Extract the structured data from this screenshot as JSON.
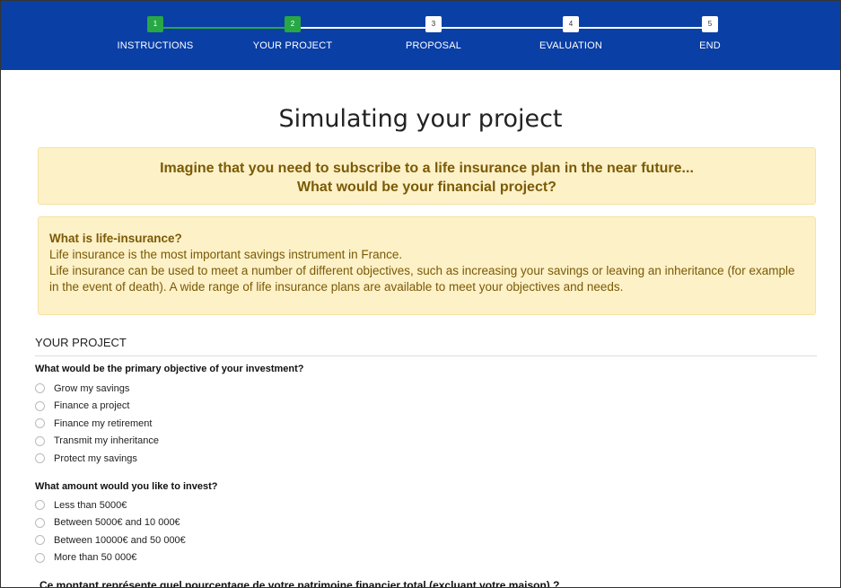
{
  "stepper": {
    "steps": [
      {
        "number": "1",
        "label": "INSTRUCTIONS"
      },
      {
        "number": "2",
        "label": "YOUR PROJECT"
      },
      {
        "number": "3",
        "label": "PROPOSAL"
      },
      {
        "number": "4",
        "label": "EVALUATION"
      },
      {
        "number": "5",
        "label": "END"
      }
    ],
    "current_step": 2,
    "colors": {
      "bar": "#0a3fa6",
      "done": "#28a745",
      "pending": "#ffffff"
    }
  },
  "page": {
    "title": "Simulating your project"
  },
  "intro": {
    "line1": "Imagine that you need to subscribe to a life insurance plan in the near future...",
    "line2": "What would be your financial project?"
  },
  "info": {
    "heading": "What is life-insurance?",
    "line1": "Life insurance is the most important savings instrument in France.",
    "line2": "Life insurance can be used to meet a number of different objectives, such as increasing your savings or leaving an inheritance (for example in the event of death). A wide range of life insurance plans are available to meet your objectives and needs."
  },
  "section": {
    "title": "YOUR PROJECT"
  },
  "questions": [
    {
      "label": "What would be the primary objective of your investment?",
      "options": [
        "Grow my savings",
        "Finance a project",
        "Finance my retirement",
        "Transmit my inheritance",
        "Protect my savings"
      ]
    },
    {
      "label": "What amount would you like to invest?",
      "options": [
        "Less than 5000€",
        "Between 5000€ and 10 000€",
        "Between 10000€ and 50 000€",
        "More than 50 000€"
      ]
    },
    {
      "label": "Ce montant représente quel pourcentage de votre patrimoine financier total (excluant votre maison) ?"
    }
  ]
}
